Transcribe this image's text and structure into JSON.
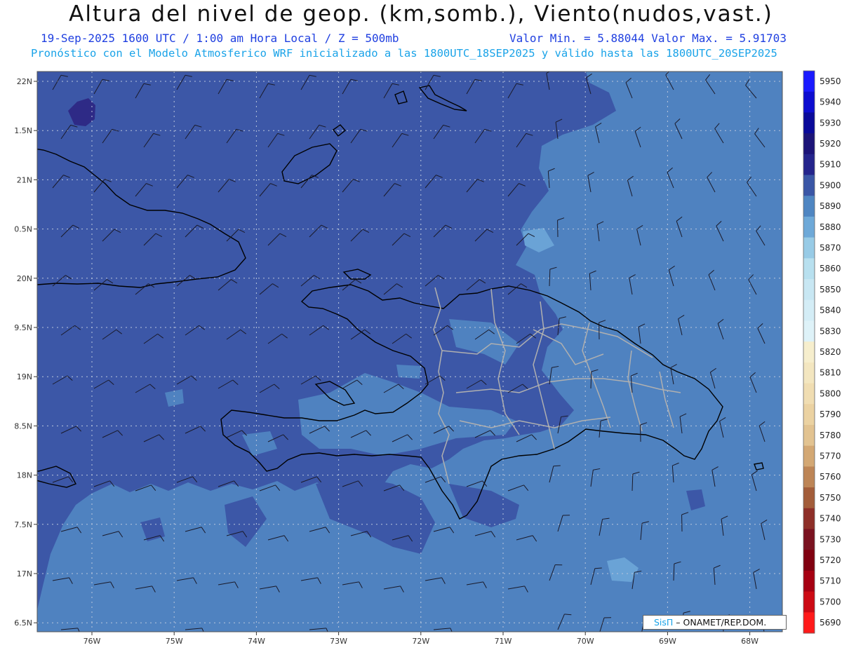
{
  "title": "Altura del nivel de geop. (km,somb.), Viento(nudos,vast.)",
  "subtitle_left": "19-Sep-2025  1600 UTC / 1:00 am Hora Local / Z = 500mb",
  "subtitle_right": "Valor Min. = 5.88044  Valor Max. = 5.91703",
  "subtitle_2": "Pronóstico con el Modelo Atmosferico WRF inicializado a las 1800UTC_18SEP2025 y válido hasta las  1800UTC_20SEP2025",
  "lat_labels": [
    "22N",
    "1.5N",
    "21N",
    "0.5N",
    "20N",
    "9.5N",
    "19N",
    "8.5N",
    "18N",
    "7.5N",
    "17N",
    "6.5N"
  ],
  "lon_labels": [
    "76W",
    "75W",
    "74W",
    "73W",
    "72W",
    "71W",
    "70W",
    "69W",
    "68W"
  ],
  "colorbar": {
    "levels": [
      "5950",
      "5940",
      "5930",
      "5920",
      "5910",
      "5900",
      "5890",
      "5880",
      "5870",
      "5860",
      "5850",
      "5840",
      "5830",
      "5820",
      "5810",
      "5800",
      "5790",
      "5780",
      "5770",
      "5760",
      "5750",
      "5740",
      "5730",
      "5720",
      "5710",
      "5700",
      "5690"
    ],
    "colors": [
      "#1a1aff",
      "#0d0dd0",
      "#0a0a9a",
      "#1c1478",
      "#24248c",
      "#3a56a6",
      "#4f86c2",
      "#6ea9d8",
      "#98cbe6",
      "#b8e0ef",
      "#c8e7f3",
      "#d4edf6",
      "#def2f8",
      "#f6eecd",
      "#f3e6c0",
      "#f0ddb2",
      "#ebd2a2",
      "#e2c391",
      "#d3a874",
      "#bd8556",
      "#a35d3a",
      "#8e2f28",
      "#7a1220",
      "#800010",
      "#a60012",
      "#cc0a14",
      "#ff1a1a"
    ]
  },
  "field_colors": {
    "z5900": "#3c57a7",
    "z5890": "#4f82c0",
    "z5910": "#2e2a86",
    "z5880": "#6aa3d6"
  },
  "credit": {
    "brand": "SisΠ",
    "text": " – ONAMET/REP.DOM."
  }
}
